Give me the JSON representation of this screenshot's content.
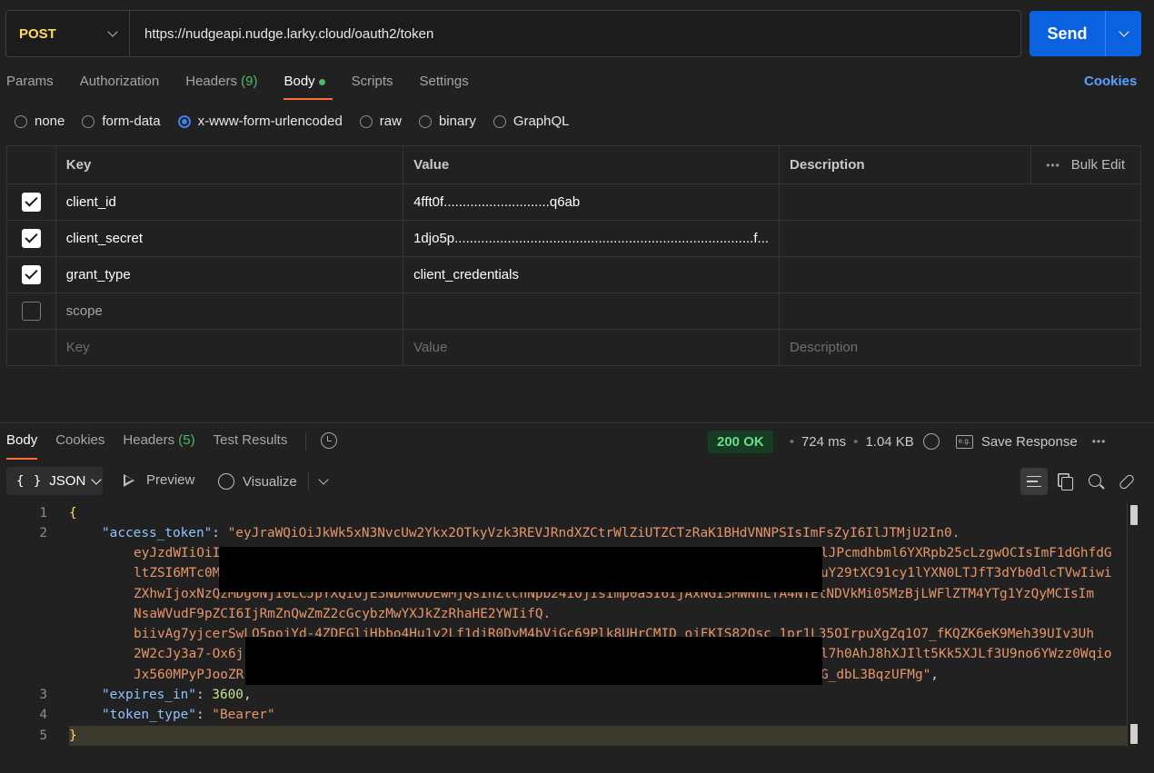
{
  "request": {
    "method": "POST",
    "url": "https://nudgeapi.nudge.larky.cloud/oauth2/token",
    "send_label": "Send"
  },
  "req_tabs": [
    {
      "label": "Params"
    },
    {
      "label": "Authorization"
    },
    {
      "label": "Headers",
      "count": "(9)"
    },
    {
      "label": "Body"
    },
    {
      "label": "Scripts"
    },
    {
      "label": "Settings"
    }
  ],
  "cookies_label": "Cookies",
  "body_types": [
    {
      "label": "none",
      "selected": false
    },
    {
      "label": "form-data",
      "selected": false
    },
    {
      "label": "x-www-form-urlencoded",
      "selected": true
    },
    {
      "label": "raw",
      "selected": false
    },
    {
      "label": "binary",
      "selected": false
    },
    {
      "label": "GraphQL",
      "selected": false
    }
  ],
  "params_table": {
    "headers": {
      "key": "Key",
      "value": "Value",
      "description": "Description",
      "bulk_edit": "Bulk Edit"
    },
    "rows": [
      {
        "checked": true,
        "key": "client_id",
        "value": "4fft0f............................q6ab",
        "description": ""
      },
      {
        "checked": true,
        "key": "client_secret",
        "value": "1djo5p...............................................................................f...",
        "description": ""
      },
      {
        "checked": true,
        "key": "grant_type",
        "value": "client_credentials",
        "description": ""
      },
      {
        "checked": false,
        "key": "scope",
        "value": "",
        "description": ""
      }
    ],
    "placeholders": {
      "key": "Key",
      "value": "Value",
      "description": "Description"
    }
  },
  "response": {
    "tabs": [
      {
        "label": "Body"
      },
      {
        "label": "Cookies"
      },
      {
        "label": "Headers",
        "count": "(5)"
      },
      {
        "label": "Test Results"
      }
    ],
    "status": "200 OK",
    "time": "724 ms",
    "size": "1.04 KB",
    "save_label": "Save Response",
    "format_label": "JSON",
    "preview_label": "Preview",
    "visualize_label": "Visualize",
    "code": {
      "line_numbers": [
        "1",
        "2",
        "3",
        "4",
        "5"
      ],
      "open_brace": "{",
      "close_brace": "}",
      "access_token_key": "\"access_token\"",
      "access_token_line1": "\"eyJraWQiOiJkWk5xN3NvcUw2Ykx2OTkyVzk3REVJRndXZCtrWlZiUTZCTzRaK1BHdVNNPSIsImFsZyI6IlJTMjU2In0.",
      "wrap_lines": [
        "eyJzdWIiOiI",
        "ltZSI6MTc0M",
        "ZXhwIjoxNzQzMDg0NjI0LCJpYXQiOjE3NDMwODEwMjQsInZlcnNpb24iOjIsImp0aSI6IjAxNGI3MWNhLTA4NTEtNDVkMi05MzBjLWFlZTM4YTg1YzQyMCIsIm",
        "NsaWVudF9pZCI6IjRmZnQwZmZ2cGcybzMwYXJkZzRhaHE2YWIifQ.",
        "biivAg7yjcerSwLQ5pojYd-4ZDEGljHbbo4Hu1y2Lf1djR0DvM4bVjGc69Plk8UHrCMID_ojFKIS82Osc_1pr1L35OIrpuXgZq1O7_fKQZK6eK9Meh39UIv3Uh",
        "2W2cJy3a7-Ox6j",
        "Jx560MPyPJooZR"
      ],
      "wrap_tails": [
        "lJPcmdhbml6YXRpb25cLzgwOCIsImF1dGhfdG",
        "uY29tXC91cy1lYXN0LTJfT3dYb0dlcTVwIiwi",
        "l7h0AhJ8hXJIlt5Kk5XJLf3U9no6YWzz0Wqio",
        "G_dbL3BqzUFMg\""
      ],
      "expires_in_key": "\"expires_in\"",
      "expires_in_value": "3600",
      "token_type_key": "\"token_type\"",
      "token_type_value": "\"Bearer\""
    }
  }
}
